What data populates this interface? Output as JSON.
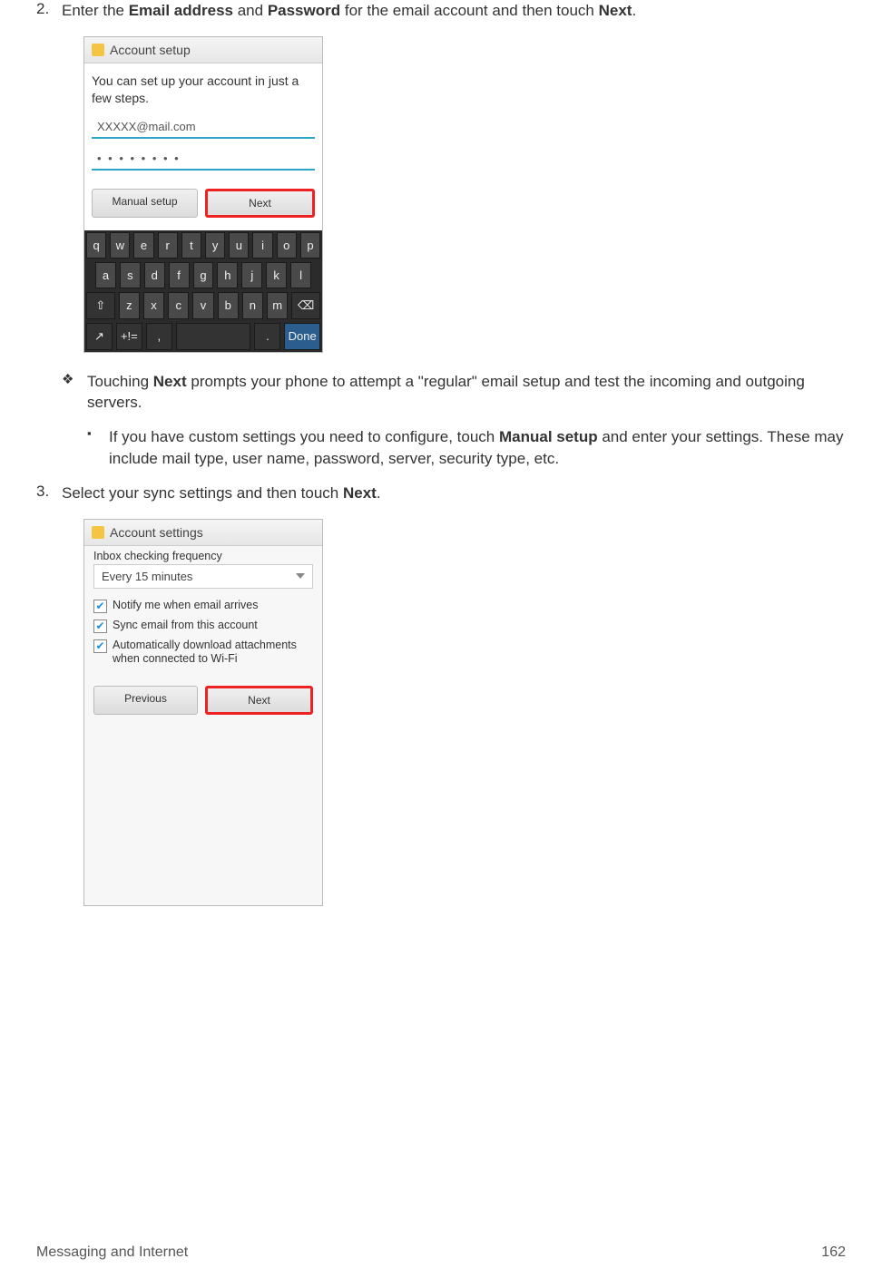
{
  "step2": {
    "num": "2.",
    "t1": "Enter the ",
    "b1": "Email address",
    "t2": " and ",
    "b2": "Password",
    "t3": " for the email account and then touch ",
    "b3": "Next",
    "t4": "."
  },
  "phone1": {
    "header": "Account setup",
    "msg": "You can set up your account in just a few steps.",
    "email": "XXXXX@mail.com",
    "pwd": "• • • • • • • •",
    "btn_manual": "Manual setup",
    "btn_next": "Next",
    "kb_done": "Done"
  },
  "kb": {
    "r1": [
      "q",
      "w",
      "e",
      "r",
      "t",
      "y",
      "u",
      "i",
      "o",
      "p"
    ],
    "r2": [
      "a",
      "s",
      "d",
      "f",
      "g",
      "h",
      "j",
      "k",
      "l"
    ],
    "r3": [
      "⇧",
      "z",
      "x",
      "c",
      "v",
      "b",
      "n",
      "m",
      "⌫"
    ],
    "r4": [
      "↗",
      "+!=",
      ",",
      " ",
      ".",
      "Done"
    ]
  },
  "sub1": {
    "mark": "❖",
    "t1": "Touching ",
    "b1": "Next",
    "t2": " prompts your phone to attempt a \"regular\" email setup and test the incoming and outgoing servers."
  },
  "sub2": {
    "mark": "▪",
    "t1": "If you have custom settings you need to configure, touch ",
    "b1": "Manual setup",
    "t2": " and enter your settings. These may include mail type, user name, password, server, security type, etc."
  },
  "step3": {
    "num": "3.",
    "t1": "Select your sync settings and then touch ",
    "b1": "Next",
    "t2": "."
  },
  "phone2": {
    "header": "Account settings",
    "label_freq": "Inbox checking frequency",
    "dd_freq": "Every 15 minutes",
    "c1": "Notify me when email arrives",
    "c2": "Sync email from this account",
    "c3": "Automatically download attachments when connected to Wi-Fi",
    "btn_prev": "Previous",
    "btn_next": "Next"
  },
  "footer": {
    "left": "Messaging and Internet",
    "right": "162"
  }
}
